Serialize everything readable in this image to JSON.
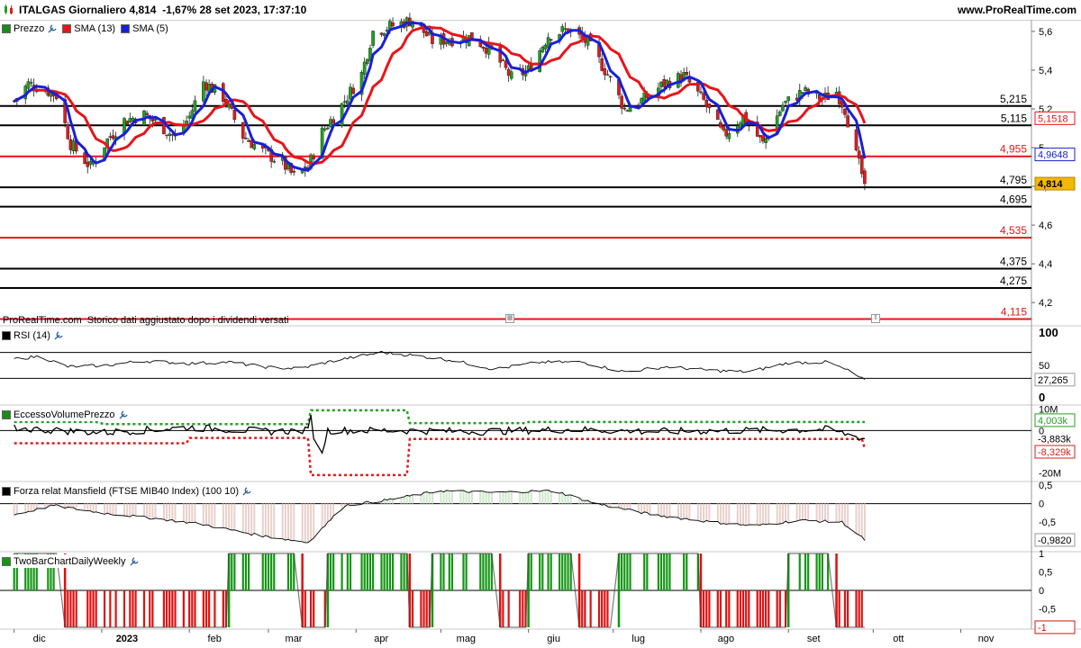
{
  "header": {
    "title": "ITALGAS Giornaliero 4,814  -1,67% 28 set 2023, 17:37:10",
    "site": "www.ProRealTime.com"
  },
  "footnote": "ProRealTime.com  Storico dati aggiustato dopo i dividendi versati",
  "legends": {
    "price": [
      {
        "label": "Prezzo",
        "color": "#1a8a1a"
      },
      {
        "label": "SMA (13)",
        "color": "#e8141a"
      },
      {
        "label": "SMA (5)",
        "color": "#1820d8"
      }
    ],
    "rsi": {
      "label": "RSI (14)"
    },
    "evp": {
      "label": "EccessoVolumePrezzo"
    },
    "mansfield": {
      "label": "Forza relat Mansfield (FTSE MIB40 Index) (100 10)"
    },
    "twobar": {
      "label": "TwoBarChartDailyWeekly"
    }
  },
  "colors": {
    "up": "#22a022",
    "down": "#dd1c1c",
    "sma13": "#e8141a",
    "sma5": "#1820d8",
    "black": "#000000",
    "mansfield_neg": "#e8d0cc",
    "mansfield_pos": "#cfe7cc",
    "twobar_green": "#149614",
    "twobar_red": "#e01010",
    "last_price_bg": "#f3b800"
  },
  "chart_data": [
    {
      "type": "candlestick",
      "panel": "price",
      "x_months": [
        "dic",
        "2023",
        "feb",
        "mar",
        "apr",
        "mag",
        "giu",
        "lug",
        "ago",
        "set",
        "ott",
        "nov"
      ],
      "x_month_starts": [
        "2022-12-01",
        "2023-01-01",
        "2023-02-01",
        "2023-03-01",
        "2023-04-01",
        "2023-05-01",
        "2023-06-01",
        "2023-07-01",
        "2023-08-01",
        "2023-09-01",
        "2023-10-01",
        "2023-11-01"
      ],
      "y_ticks": [
        4.2,
        4.4,
        4.6,
        4.8,
        5.0,
        5.2,
        5.4,
        5.6
      ],
      "y_tick_labels": [
        "4,2",
        "4,4",
        "4,6",
        "4,8",
        "5",
        "5,2",
        "5,4",
        "5,6"
      ],
      "ylim": [
        4.08,
        5.66
      ],
      "close_path": [
        [
          "2022-12-01",
          5.24
        ],
        [
          "2022-12-06",
          5.33
        ],
        [
          "2022-12-12",
          5.3
        ],
        [
          "2022-12-16",
          5.27
        ],
        [
          "2022-12-21",
          5.02
        ],
        [
          "2022-12-28",
          4.9
        ],
        [
          "2023-01-03",
          5.04
        ],
        [
          "2023-01-09",
          5.14
        ],
        [
          "2023-01-16",
          5.17
        ],
        [
          "2023-01-23",
          5.1
        ],
        [
          "2023-01-27",
          5.05
        ],
        [
          "2023-02-01",
          5.16
        ],
        [
          "2023-02-06",
          5.34
        ],
        [
          "2023-02-13",
          5.26
        ],
        [
          "2023-02-20",
          5.06
        ],
        [
          "2023-02-27",
          4.98
        ],
        [
          "2023-03-06",
          4.92
        ],
        [
          "2023-03-10",
          4.85
        ],
        [
          "2023-03-15",
          4.9
        ],
        [
          "2023-03-20",
          5.08
        ],
        [
          "2023-03-27",
          5.22
        ],
        [
          "2023-04-03",
          5.38
        ],
        [
          "2023-04-07",
          5.6
        ],
        [
          "2023-04-14",
          5.63
        ],
        [
          "2023-04-21",
          5.66
        ],
        [
          "2023-04-28",
          5.55
        ],
        [
          "2023-05-05",
          5.56
        ],
        [
          "2023-05-12",
          5.57
        ],
        [
          "2023-05-19",
          5.5
        ],
        [
          "2023-05-26",
          5.36
        ],
        [
          "2023-06-01",
          5.4
        ],
        [
          "2023-06-08",
          5.58
        ],
        [
          "2023-06-15",
          5.61
        ],
        [
          "2023-06-22",
          5.54
        ],
        [
          "2023-06-29",
          5.38
        ],
        [
          "2023-07-05",
          5.2
        ],
        [
          "2023-07-12",
          5.25
        ],
        [
          "2023-07-19",
          5.33
        ],
        [
          "2023-07-26",
          5.37
        ],
        [
          "2023-08-02",
          5.24
        ],
        [
          "2023-08-09",
          5.06
        ],
        [
          "2023-08-16",
          5.16
        ],
        [
          "2023-08-23",
          5.02
        ],
        [
          "2023-08-30",
          5.22
        ],
        [
          "2023-09-06",
          5.29
        ],
        [
          "2023-09-13",
          5.25
        ],
        [
          "2023-09-18",
          5.29
        ],
        [
          "2023-09-21",
          5.2
        ],
        [
          "2023-09-25",
          4.96
        ],
        [
          "2023-09-28",
          4.814
        ]
      ],
      "last_price": "4,814",
      "sma13_last": "5,1518",
      "sma5_last": "4,9648",
      "levels": [
        {
          "value": 5.215,
          "label": "5,215",
          "color": "#000000"
        },
        {
          "value": 5.115,
          "label": "5,115",
          "color": "#000000"
        },
        {
          "value": 4.955,
          "label": "4,955",
          "color": "#e8141a"
        },
        {
          "value": 4.795,
          "label": "4,795",
          "color": "#000000"
        },
        {
          "value": 4.695,
          "label": "4,695",
          "color": "#000000"
        },
        {
          "value": 4.535,
          "label": "4,535",
          "color": "#e8141a"
        },
        {
          "value": 4.375,
          "label": "4,375",
          "color": "#000000"
        },
        {
          "value": 4.275,
          "label": "4,275",
          "color": "#000000"
        },
        {
          "value": 4.115,
          "label": "4,115",
          "color": "#e8141a"
        }
      ]
    },
    {
      "type": "line",
      "panel": "rsi",
      "y_ticks": [
        0,
        50,
        100
      ],
      "y_tick_labels": [
        "0",
        "50",
        "100"
      ],
      "ylim": [
        0,
        100
      ],
      "last_value": "27,265",
      "path": [
        [
          "2022-12-01",
          60
        ],
        [
          "2022-12-10",
          64
        ],
        [
          "2022-12-20",
          48
        ],
        [
          "2023-01-03",
          50
        ],
        [
          "2023-01-15",
          57
        ],
        [
          "2023-02-01",
          53
        ],
        [
          "2023-02-15",
          55
        ],
        [
          "2023-03-01",
          47
        ],
        [
          "2023-03-12",
          45
        ],
        [
          "2023-03-25",
          58
        ],
        [
          "2023-04-10",
          70
        ],
        [
          "2023-04-22",
          65
        ],
        [
          "2023-05-05",
          58
        ],
        [
          "2023-05-20",
          44
        ],
        [
          "2023-06-05",
          55
        ],
        [
          "2023-06-20",
          55
        ],
        [
          "2023-07-05",
          40
        ],
        [
          "2023-07-20",
          48
        ],
        [
          "2023-08-05",
          42
        ],
        [
          "2023-08-18",
          40
        ],
        [
          "2023-09-01",
          54
        ],
        [
          "2023-09-15",
          55
        ],
        [
          "2023-09-22",
          42
        ],
        [
          "2023-09-28",
          27
        ]
      ]
    },
    {
      "type": "line",
      "panel": "evp",
      "y_ticks": [
        10000000,
        0,
        -20000000
      ],
      "y_tick_labels": [
        "10M",
        "0",
        "-20M"
      ],
      "ylim": [
        -24000000,
        12000000
      ],
      "value_labels": [
        "4,003k",
        "-3,883k",
        "-8,329k"
      ],
      "upper_path": [
        [
          "2022-12-01",
          4000000
        ],
        [
          "2023-01-01",
          3000000
        ],
        [
          "2023-03-15",
          3000000
        ],
        [
          "2023-03-16",
          9500000
        ],
        [
          "2023-04-12",
          9500000
        ],
        [
          "2023-04-20",
          3500000
        ],
        [
          "2023-06-01",
          4000000
        ],
        [
          "2023-07-05",
          4000000
        ],
        [
          "2023-09-28",
          4003000
        ]
      ],
      "lower_path": [
        [
          "2022-12-01",
          -6000000
        ],
        [
          "2023-01-01",
          -6000000
        ],
        [
          "2023-02-01",
          -3500000
        ],
        [
          "2023-03-15",
          -3500000
        ],
        [
          "2023-03-16",
          -21000000
        ],
        [
          "2023-04-12",
          -21000000
        ],
        [
          "2023-04-20",
          -4000000
        ],
        [
          "2023-09-28",
          -8329000
        ]
      ],
      "main_path": [
        [
          "2022-12-01",
          1000000
        ],
        [
          "2023-01-01",
          -1000000
        ],
        [
          "2023-02-01",
          1500000
        ],
        [
          "2023-03-01",
          -500000
        ],
        [
          "2023-03-15",
          0
        ],
        [
          "2023-03-16",
          9000000
        ],
        [
          "2023-03-18",
          -19000000
        ],
        [
          "2023-03-22",
          0
        ],
        [
          "2023-04-15",
          0
        ],
        [
          "2023-05-15",
          -500000
        ],
        [
          "2023-06-15",
          500000
        ],
        [
          "2023-07-15",
          -500000
        ],
        [
          "2023-08-15",
          0
        ],
        [
          "2023-09-15",
          500000
        ],
        [
          "2023-09-28",
          -3883000
        ]
      ]
    },
    {
      "type": "area",
      "panel": "mansfield",
      "y_ticks": [
        0.5,
        0,
        -0.5,
        -1
      ],
      "y_tick_labels": [
        "0,5",
        "0",
        "-0,5",
        "-1"
      ],
      "ylim": [
        -1.25,
        0.55
      ],
      "last_value": "-0,9820",
      "path": [
        [
          "2022-12-01",
          -0.3
        ],
        [
          "2022-12-15",
          -0.05
        ],
        [
          "2023-01-01",
          -0.25
        ],
        [
          "2023-01-20",
          -0.4
        ],
        [
          "2023-02-05",
          -0.55
        ],
        [
          "2023-02-25",
          -0.85
        ],
        [
          "2023-03-15",
          -1.05
        ],
        [
          "2023-03-28",
          -0.05
        ],
        [
          "2023-04-12",
          0.1
        ],
        [
          "2023-05-01",
          0.35
        ],
        [
          "2023-05-20",
          0.3
        ],
        [
          "2023-06-10",
          0.35
        ],
        [
          "2023-06-25",
          0.0
        ],
        [
          "2023-07-15",
          -0.3
        ],
        [
          "2023-08-05",
          -0.5
        ],
        [
          "2023-08-20",
          -0.6
        ],
        [
          "2023-09-05",
          -0.45
        ],
        [
          "2023-09-20",
          -0.5
        ],
        [
          "2023-09-28",
          -0.98
        ]
      ]
    },
    {
      "type": "bar",
      "panel": "twobar",
      "y_ticks": [
        1,
        0.5,
        0,
        -0.5,
        -1
      ],
      "y_tick_labels": [
        "1",
        "0,5",
        "0",
        "-0,5",
        "-1"
      ],
      "ylim": [
        -1.05,
        1.05
      ],
      "last_value": "-1",
      "regimes": [
        [
          "2022-12-01",
          1
        ],
        [
          "2022-12-18",
          -1
        ],
        [
          "2023-02-15",
          1
        ],
        [
          "2023-03-12",
          -1
        ],
        [
          "2023-03-22",
          1
        ],
        [
          "2023-04-20",
          -1
        ],
        [
          "2023-04-28",
          1
        ],
        [
          "2023-05-20",
          -1
        ],
        [
          "2023-06-01",
          1
        ],
        [
          "2023-06-18",
          -1
        ],
        [
          "2023-07-01",
          1
        ],
        [
          "2023-08-01",
          -1
        ],
        [
          "2023-09-01",
          1
        ],
        [
          "2023-09-18",
          -1
        ]
      ]
    }
  ]
}
